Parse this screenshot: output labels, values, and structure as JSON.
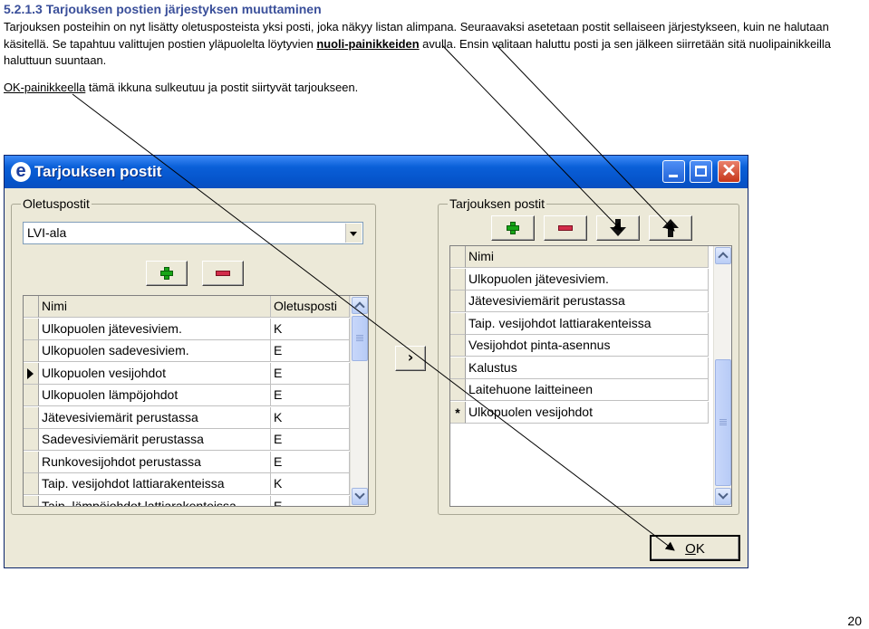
{
  "doc": {
    "heading": "5.2.1.3 Tarjouksen postien järjestyksen muuttaminen",
    "paragraph": {
      "part1": "Tarjouksen posteihin on nyt lisätty oletusposteista yksi posti, joka näkyy listan alimpana. Seuraavaksi asetetaan postit sellaiseen järjestykseen, kuin ne halutaan käsitellä. Se  tapahtuu valittujen postien yläpuolelta löytyvien ",
      "link": "nuoli-painikkeiden",
      "part2": " avulla. Ensin valitaan haluttu posti ja sen jälkeen siirretään sitä nuolipainikkeilla haluttuun suuntaan."
    },
    "ok_line": {
      "link": "OK-painikkeella",
      "rest": " tämä ikkuna sulkeutuu ja postit siirtyvät tarjoukseen."
    },
    "page_number": "20"
  },
  "window": {
    "title": "Tarjouksen postit",
    "icon": "e",
    "icon_name": "app-e-icon",
    "title_color": "#0553c9",
    "left": {
      "group_label": "Oletuspostit",
      "combo_value": "LVI-ala",
      "columns": [
        "Nimi",
        "Oletusposti"
      ],
      "selected_row": 2,
      "rows": [
        [
          "Ulkopuolen jätevesiviem.",
          "K"
        ],
        [
          "Ulkopuolen sadevesiviem.",
          "E"
        ],
        [
          "Ulkopuolen vesijohdot",
          "E"
        ],
        [
          "Ulkopuolen lämpöjohdot",
          "E"
        ],
        [
          "Jätevesiviemärit perustassa",
          "K"
        ],
        [
          "Sadevesiviemärit perustassa",
          "E"
        ],
        [
          "Runkovesijohdot perustassa",
          "E"
        ],
        [
          "Taip. vesijohdot lattiarakenteissa",
          "K"
        ],
        [
          "Taip. lämpöjohdot lattiarakenteissa",
          "E"
        ]
      ]
    },
    "transfer_button": "›",
    "right": {
      "group_label": "Tarjouksen postit",
      "columns": [
        "Nimi"
      ],
      "new_row_marker": "*",
      "rows": [
        "Ulkopuolen jätevesiviem.",
        "Jätevesiviemärit perustassa",
        "Taip. vesijohdot lattiarakenteissa",
        "Vesijohdot pinta-asennus",
        "Kalustus",
        "Laitehuone laitteineen",
        "Ulkopuolen vesijohdot"
      ]
    },
    "ok_button": {
      "prefix": "O",
      "suffix": "K"
    }
  }
}
